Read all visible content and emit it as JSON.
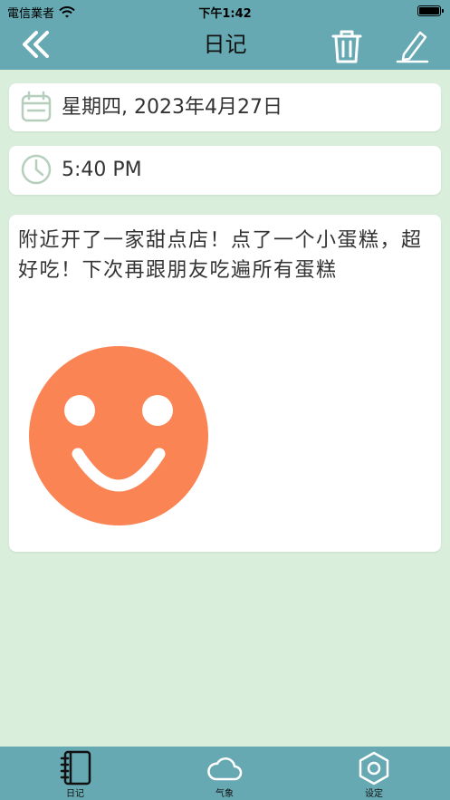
{
  "status_bar": {
    "carrier": "電信業者",
    "time": "下午1:42"
  },
  "nav": {
    "title": "日记",
    "icons": [
      "back-chevrons-icon",
      "trash-icon",
      "edit-pencil-icon"
    ]
  },
  "entry": {
    "date": "星期四, 2023年4月27日",
    "time": "5:40 PM",
    "content": "附近开了一家甜点店！点了一个小蛋糕，超好吃！下次再跟朋友吃遍所有蛋糕",
    "mood_icon": "smiley-face-icon",
    "mood_color": "#fb8454"
  },
  "tabs": [
    {
      "label": "日记",
      "icon": "notebook-icon",
      "selected": true
    },
    {
      "label": "气象",
      "icon": "cloud-icon",
      "selected": false
    },
    {
      "label": "设定",
      "icon": "hexagon-settings-icon",
      "selected": false
    }
  ],
  "colors": {
    "header": "#67a9b2",
    "background": "#d9eedb",
    "card": "#ffffff",
    "card_icon": "#b6cfbd"
  }
}
